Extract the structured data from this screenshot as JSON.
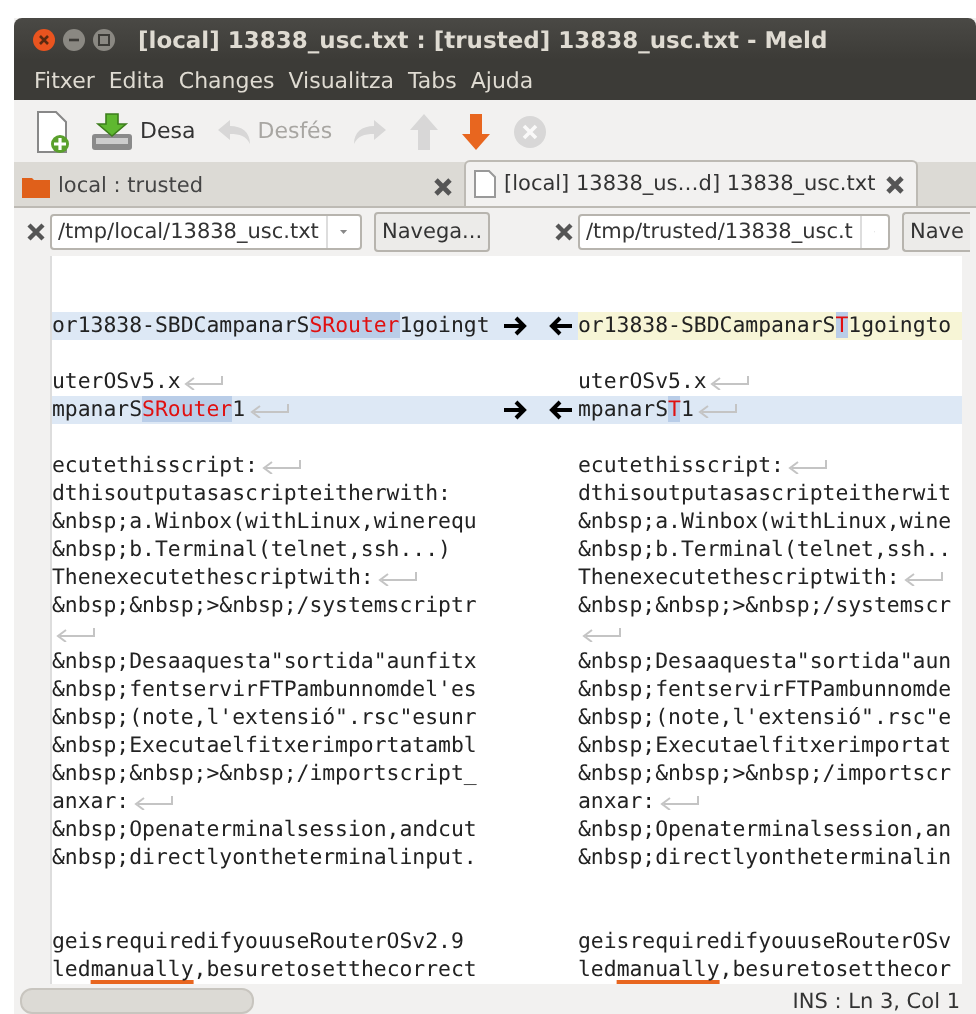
{
  "window": {
    "title": "[local] 13838_usc.txt : [trusted] 13838_usc.txt - Meld"
  },
  "menu": [
    "Fitxer",
    "Edita",
    "Changes",
    "Visualitza",
    "Tabs",
    "Ajuda"
  ],
  "toolbar": [
    {
      "kind": "new",
      "disabled": false
    },
    {
      "kind": "save",
      "label": "Desa",
      "disabled": false
    },
    {
      "kind": "undo",
      "label": "Desfés",
      "disabled": true
    },
    {
      "kind": "redo",
      "disabled": true
    },
    {
      "kind": "up",
      "disabled": true
    },
    {
      "kind": "down",
      "disabled": false
    },
    {
      "kind": "stop",
      "disabled": true
    }
  ],
  "tabs": [
    {
      "kind": "folder",
      "label": "local : trusted",
      "selected": false
    },
    {
      "kind": "file",
      "label": "[local] 13838_us…d] 13838_usc.txt",
      "selected": true
    }
  ],
  "panes": [
    {
      "path": "/tmp/local/13838_usc.txt",
      "browse": "Navega..."
    },
    {
      "path": "/tmp/trusted/13838_usc.t",
      "browse": "Nave"
    }
  ],
  "rows": [
    {
      "kind": "plain"
    },
    {
      "kind": "plain"
    },
    {
      "kind": "changed",
      "left": {
        "current": false,
        "segments": [
          {
            "text": "or13838-SBDCampanarS",
            "changed": false
          },
          {
            "text": "SRouter",
            "changed": true
          },
          {
            "text": "1goingt",
            "changed": false
          }
        ]
      },
      "right": {
        "current": true,
        "segments": [
          {
            "text": "or13838-SBDCampanarS",
            "changed": false
          },
          {
            "text": "T",
            "changed": true
          },
          {
            "text": "1goingto",
            "changed": false
          }
        ]
      }
    },
    {
      "kind": "plain"
    },
    {
      "kind": "plain",
      "left": {
        "eol": true,
        "segments": [
          {
            "text": "uterOSv5.x"
          }
        ]
      },
      "right": {
        "eol": true,
        "segments": [
          {
            "text": "uterOSv5.x"
          }
        ]
      }
    },
    {
      "kind": "changed",
      "left": {
        "current": false,
        "eol": true,
        "segments": [
          {
            "text": "mpanarS",
            "changed": false
          },
          {
            "text": "SRouter",
            "changed": true
          },
          {
            "text": "1",
            "changed": false
          }
        ]
      },
      "right": {
        "current": false,
        "eol": true,
        "segments": [
          {
            "text": "mpanarS",
            "changed": false
          },
          {
            "text": "T",
            "changed": true
          },
          {
            "text": "1",
            "changed": false
          }
        ]
      }
    },
    {
      "kind": "plain"
    },
    {
      "kind": "plain",
      "left": {
        "eol": true,
        "segments": [
          {
            "text": "ecutethisscript:"
          }
        ]
      },
      "right": {
        "eol": true,
        "segments": [
          {
            "text": "ecutethisscript:"
          }
        ]
      }
    },
    {
      "kind": "plain",
      "left": {
        "segments": [
          {
            "text": "dthisoutputasascripteitherwith:"
          }
        ]
      },
      "right": {
        "segments": [
          {
            "text": "dthisoutputasascripteitherwit"
          }
        ]
      }
    },
    {
      "kind": "plain",
      "left": {
        "segments": [
          {
            "text": "&nbsp;a.Winbox(withLinux,winerequ"
          }
        ]
      },
      "right": {
        "segments": [
          {
            "text": "&nbsp;a.Winbox(withLinux,wine"
          }
        ]
      }
    },
    {
      "kind": "plain",
      "left": {
        "segments": [
          {
            "text": "&nbsp;b.Terminal(telnet,ssh...)"
          }
        ]
      },
      "right": {
        "segments": [
          {
            "text": "&nbsp;b.Terminal(telnet,ssh.."
          }
        ]
      }
    },
    {
      "kind": "plain",
      "left": {
        "eol": true,
        "segments": [
          {
            "text": "Thenexecutethescriptwith:"
          }
        ]
      },
      "right": {
        "eol": true,
        "segments": [
          {
            "text": "Thenexecutethescriptwith:"
          }
        ]
      }
    },
    {
      "kind": "plain",
      "left": {
        "segments": [
          {
            "text": "&nbsp;&nbsp;>&nbsp;/systemscriptr"
          }
        ]
      },
      "right": {
        "segments": [
          {
            "text": "&nbsp;&nbsp;>&nbsp;/systemscr"
          }
        ]
      }
    },
    {
      "kind": "plain",
      "left": {
        "eol": true
      },
      "right": {
        "eol": true
      }
    },
    {
      "kind": "plain",
      "left": {
        "segments": [
          {
            "text": "&nbsp;Desaaquesta\"sortida\"aunfitx"
          }
        ]
      },
      "right": {
        "segments": [
          {
            "text": "&nbsp;Desaaquesta\"sortida\"aun"
          }
        ]
      }
    },
    {
      "kind": "plain",
      "left": {
        "segments": [
          {
            "text": "&nbsp;fentservirFTPambunnomdel'es"
          }
        ]
      },
      "right": {
        "segments": [
          {
            "text": "&nbsp;fentservirFTPambunnomde"
          }
        ]
      }
    },
    {
      "kind": "plain",
      "left": {
        "segments": [
          {
            "text": "&nbsp;(note,l'extensió\".rsc\"esunr"
          }
        ]
      },
      "right": {
        "segments": [
          {
            "text": "&nbsp;(note,l'extensió\".rsc\"e"
          }
        ]
      }
    },
    {
      "kind": "plain",
      "left": {
        "segments": [
          {
            "text": "&nbsp;Executaelfitxerimportatambl"
          }
        ]
      },
      "right": {
        "segments": [
          {
            "text": "&nbsp;Executaelfitxerimportat"
          }
        ]
      }
    },
    {
      "kind": "plain",
      "left": {
        "segments": [
          {
            "text": "&nbsp;&nbsp;>&nbsp;/importscript_"
          }
        ]
      },
      "right": {
        "segments": [
          {
            "text": "&nbsp;&nbsp;>&nbsp;/importscr"
          }
        ]
      }
    },
    {
      "kind": "plain",
      "left": {
        "eol": true,
        "segments": [
          {
            "text": "anxar:"
          }
        ]
      },
      "right": {
        "eol": true,
        "segments": [
          {
            "text": "anxar:"
          }
        ]
      }
    },
    {
      "kind": "plain",
      "left": {
        "segments": [
          {
            "text": "&nbsp;Openaterminalsession,andcut"
          }
        ]
      },
      "right": {
        "segments": [
          {
            "text": "&nbsp;Openaterminalsession,an"
          }
        ]
      }
    },
    {
      "kind": "plain",
      "left": {
        "segments": [
          {
            "text": "&nbsp;directlyontheterminalinput."
          }
        ]
      },
      "right": {
        "segments": [
          {
            "text": "&nbsp;directlyontheterminalin"
          }
        ]
      }
    },
    {
      "kind": "plain"
    },
    {
      "kind": "plain"
    },
    {
      "kind": "plain",
      "left": {
        "segments": [
          {
            "text": "geisrequiredifyouuseRouterOSv2.9"
          }
        ]
      },
      "right": {
        "segments": [
          {
            "text": "geisrequiredifyouuseRouterOSv"
          }
        ]
      }
    },
    {
      "kind": "plain",
      "left": {
        "segments": [
          {
            "text": "led",
            "misspelled": false
          },
          {
            "text": "manually",
            "misspelled": true
          },
          {
            "text": ",besuretosetthecorrect",
            "misspelled": false
          }
        ]
      },
      "right": {
        "segments": [
          {
            "text": "led",
            "misspelled": false
          },
          {
            "text": "manually",
            "misspelled": true
          },
          {
            "text": ",besuretosetthecor",
            "misspelled": false
          }
        ]
      }
    }
  ],
  "status_bar": {
    "text": "INS : Ln 3, Col 1"
  }
}
